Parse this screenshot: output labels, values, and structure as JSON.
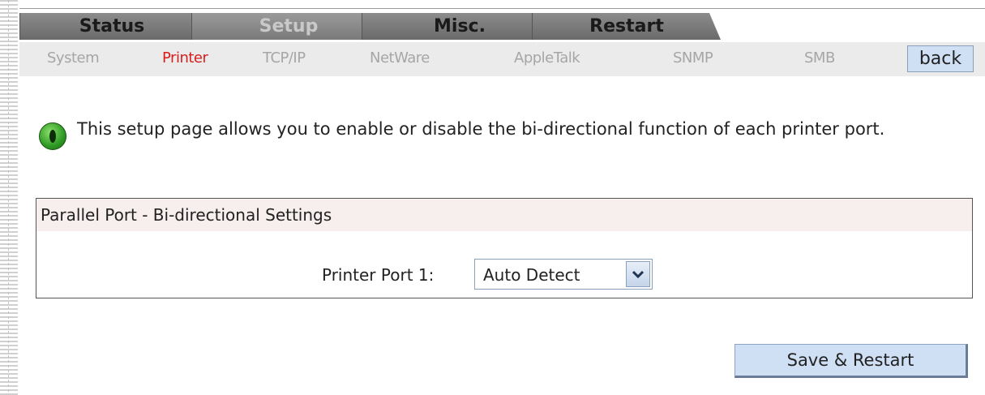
{
  "main_tabs": [
    {
      "label": "Status"
    },
    {
      "label": "Setup"
    },
    {
      "label": "Misc."
    },
    {
      "label": "Restart"
    }
  ],
  "sub_nav": {
    "items": [
      {
        "label": "System"
      },
      {
        "label": "Printer"
      },
      {
        "label": "TCP/IP"
      },
      {
        "label": "NetWare"
      },
      {
        "label": "AppleTalk"
      },
      {
        "label": "SNMP"
      },
      {
        "label": "SMB"
      }
    ],
    "back_label": "back"
  },
  "info": {
    "text": "This setup page allows you to enable or disable the bi-directional function of each printer port."
  },
  "settings": {
    "header": "Parallel Port - Bi-directional Settings",
    "port_label": "Printer Port 1:",
    "port_value": "Auto Detect"
  },
  "actions": {
    "save_label": "Save & Restart"
  },
  "colors": {
    "active_sub": "#d81d1d",
    "button_bg": "#cfe0f5",
    "header_bg": "#f7eeee"
  }
}
